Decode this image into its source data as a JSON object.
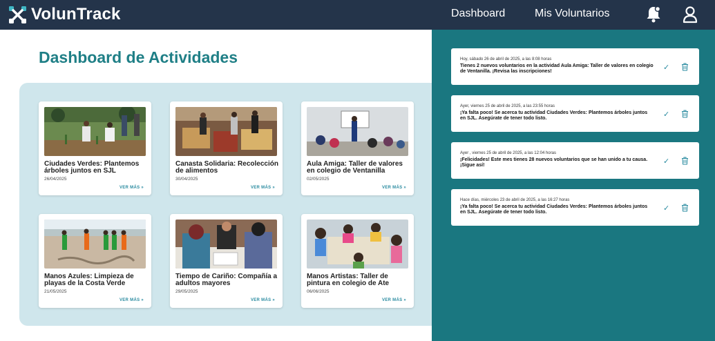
{
  "brand": {
    "name": "VolunTrack"
  },
  "nav": {
    "dashboard": "Dashboard",
    "volunteers": "Mis Voluntarios"
  },
  "page": {
    "title": "Dashboard de Actividades"
  },
  "cards": [
    {
      "title": "Ciudades Verdes: Plantemos árboles juntos en SJL",
      "date": "26/04/2025",
      "more": "VER MÁS »"
    },
    {
      "title": "Canasta Solidaria: Recolección de alimentos",
      "date": "30/04/2025",
      "more": "VER MÁS »"
    },
    {
      "title": "Aula Amiga: Taller de valores en colegio de Ventanilla",
      "date": "02/05/2025",
      "more": "VER MÁS »"
    },
    {
      "title": "Manos Azules: Limpieza de playas de la Costa Verde",
      "date": "21/05/2025",
      "more": "VER MÁS »"
    },
    {
      "title": "Tiempo de Cariño: Compañía a adultos mayores",
      "date": "29/05/2025",
      "more": "VER MÁS »"
    },
    {
      "title": "Manos Artistas: Taller de pintura en colegio de Ate",
      "date": "06/06/2025",
      "more": "VER MÁS »"
    }
  ],
  "notifications": [
    {
      "time": "Hoy, sábado 26 de abril de 2025, a las 8:08 horas",
      "message": "Tienes 2 nuevos voluntarios en la actividad Aula Amiga: Taller de valores en colegio de Ventanilla. ¡Revisa las inscripciones!"
    },
    {
      "time": "Ayer, viernes 25 de abril de 2025, a las 23:55 horas",
      "message": "¡Ya falta poco! Se acerca tu actividad Ciudades Verdes: Plantemos árboles juntos en SJL. Asegúrate de tener todo listo."
    },
    {
      "time": "Ayer , viernes 25 de abril de 2025, a las 12:04 horas",
      "message": "¡Felicidades! Este mes tienes 28 nuevos voluntarios que se han unido a tu causa. ¡Sigue así!"
    },
    {
      "time": "Hace días, miércoles 23 de abril de 2025, a las 16:27 horas",
      "message": "¡Ya falta poco! Se acerca tu actividad Ciudades Verdes: Plantemos árboles juntos en SJL. Asegúrate de tener todo listo."
    }
  ],
  "icons": {
    "check": "✓",
    "logo": "voluntrack-logo",
    "bell": "bell-icon",
    "user": "user-icon",
    "trash": "trash-icon"
  },
  "colors": {
    "navbar": "#24344a",
    "title": "#1f7f86",
    "board": "#cfe6ec",
    "panel": "#1a7780",
    "accent": "#2a8ba0"
  }
}
